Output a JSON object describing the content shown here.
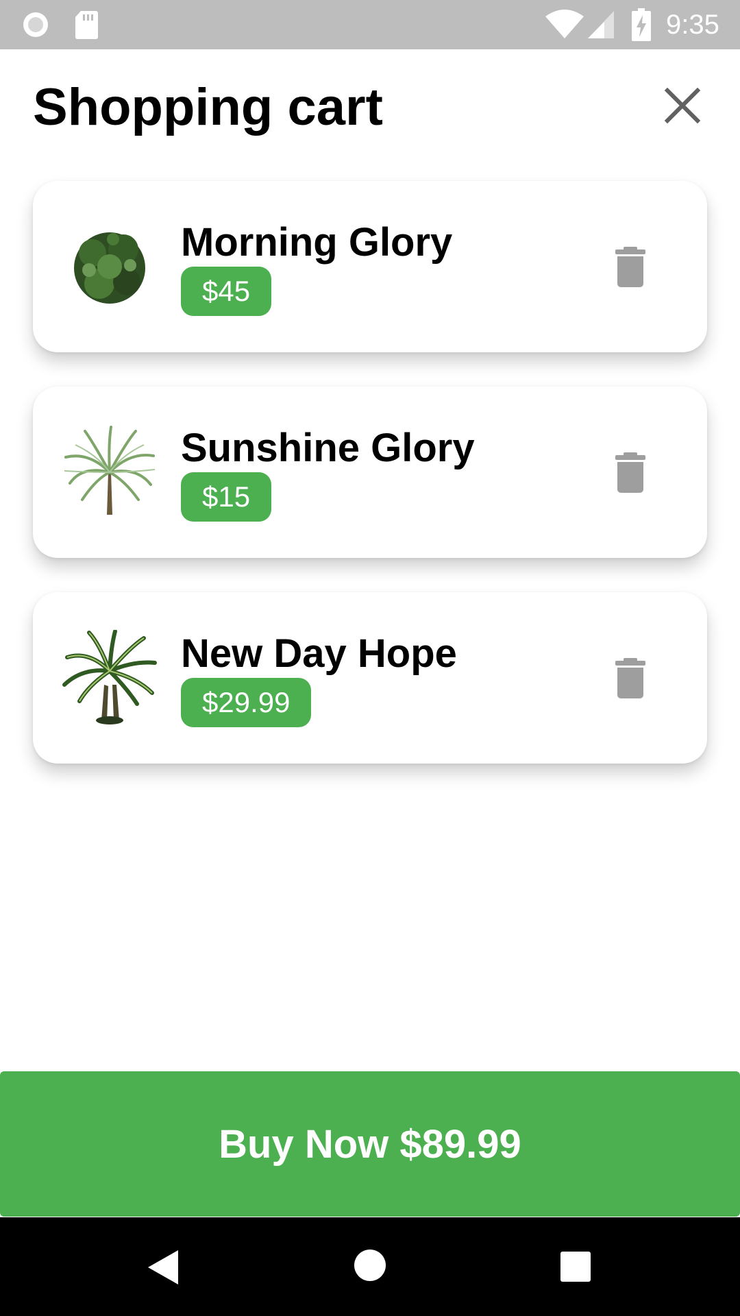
{
  "status_bar": {
    "time": "9:35",
    "icons": [
      "record-icon",
      "sd-card-icon",
      "wifi-icon",
      "cell-signal-icon",
      "battery-charging-icon"
    ]
  },
  "header": {
    "title": "Shopping cart",
    "close_icon": "close-icon"
  },
  "cart": {
    "items": [
      {
        "name": "Morning Glory",
        "price": "$45",
        "image": "shrub-plant-image",
        "delete_icon": "trash-icon"
      },
      {
        "name": "Sunshine Glory",
        "price": "$15",
        "image": "palm-plant-image",
        "delete_icon": "trash-icon"
      },
      {
        "name": "New Day Hope",
        "price": "$29.99",
        "image": "dracaena-plant-image",
        "delete_icon": "trash-icon"
      }
    ]
  },
  "checkout": {
    "label": "Buy Now $89.99"
  },
  "nav_bar": {
    "icons": [
      "back-icon",
      "home-icon",
      "recents-icon"
    ]
  },
  "colors": {
    "accent": "#4caf50",
    "status_bar": "#bdbdbd",
    "icon_gray": "#9e9e9e",
    "nav_bar": "#000000"
  }
}
